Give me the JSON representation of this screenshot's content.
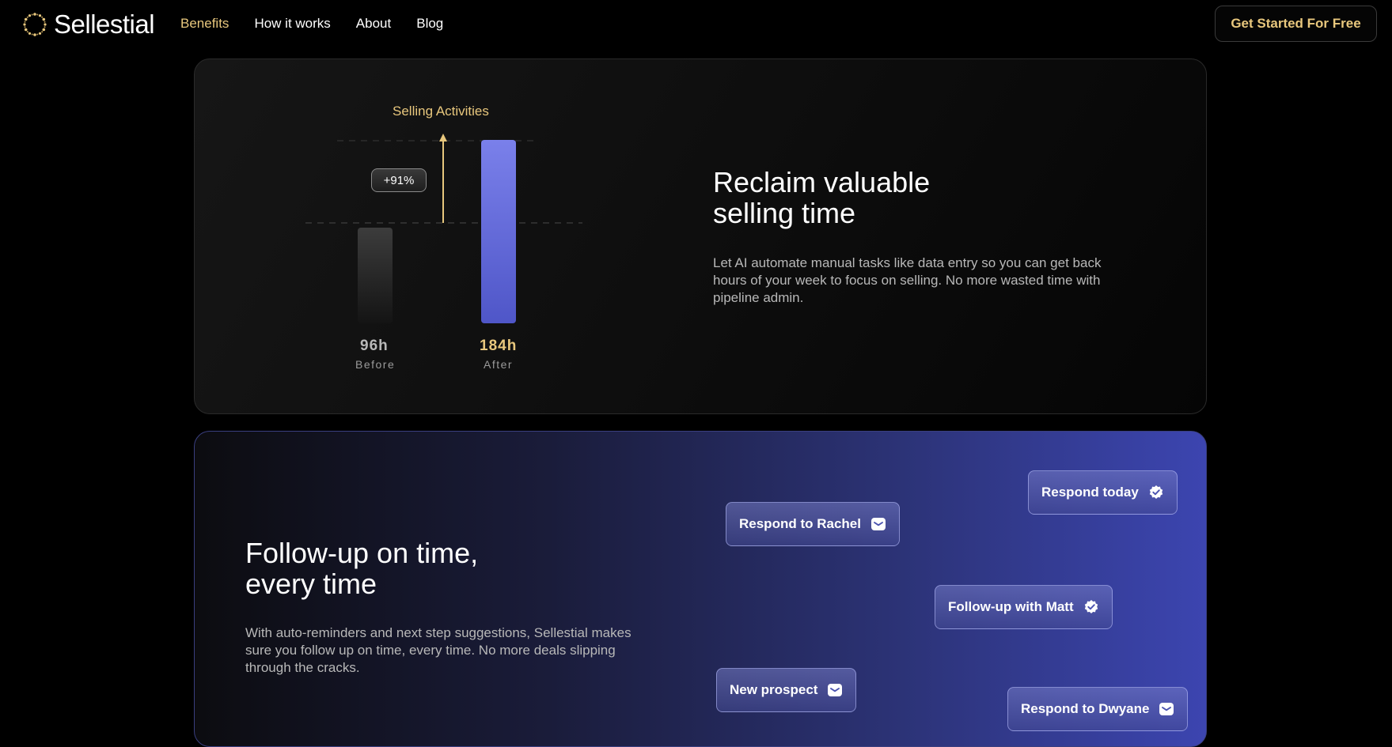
{
  "nav": {
    "brand": "Sellestial",
    "links": [
      {
        "label": "Benefits",
        "active": true
      },
      {
        "label": "How it works",
        "active": false
      },
      {
        "label": "About",
        "active": false
      },
      {
        "label": "Blog",
        "active": false
      }
    ],
    "cta": "Get Started For Free"
  },
  "colors": {
    "accent": "#e8c77d",
    "bar_after": "#6b72e0",
    "bar_before": "#3a3a3a"
  },
  "selling_time": {
    "chart_data": {
      "type": "bar",
      "title": "Selling Activities",
      "categories": [
        "Before",
        "After"
      ],
      "values": [
        96,
        184
      ],
      "value_labels": [
        "96h",
        "184h"
      ],
      "change_label": "+91%"
    },
    "heading_line1": "Reclaim valuable",
    "heading_line2": "selling time",
    "body": "Let AI automate manual tasks like data entry so you can get back hours of your week to focus on selling. No more wasted time with pipeline admin."
  },
  "follow_up": {
    "heading_line1": "Follow-up on time,",
    "heading_line2": "every time",
    "body": "With auto-reminders and next step suggestions, Sellestial makes sure you follow up on time, every time. No more deals slipping through the cracks.",
    "chips": [
      {
        "label": "Respond today",
        "icon": "badge-check-icon"
      },
      {
        "label": "Respond to Rachel",
        "icon": "mail-icon"
      },
      {
        "label": "Follow-up with Matt",
        "icon": "badge-check-icon"
      },
      {
        "label": "New prospect",
        "icon": "mail-icon"
      },
      {
        "label": "Respond to Dwyane",
        "icon": "mail-icon"
      }
    ]
  }
}
